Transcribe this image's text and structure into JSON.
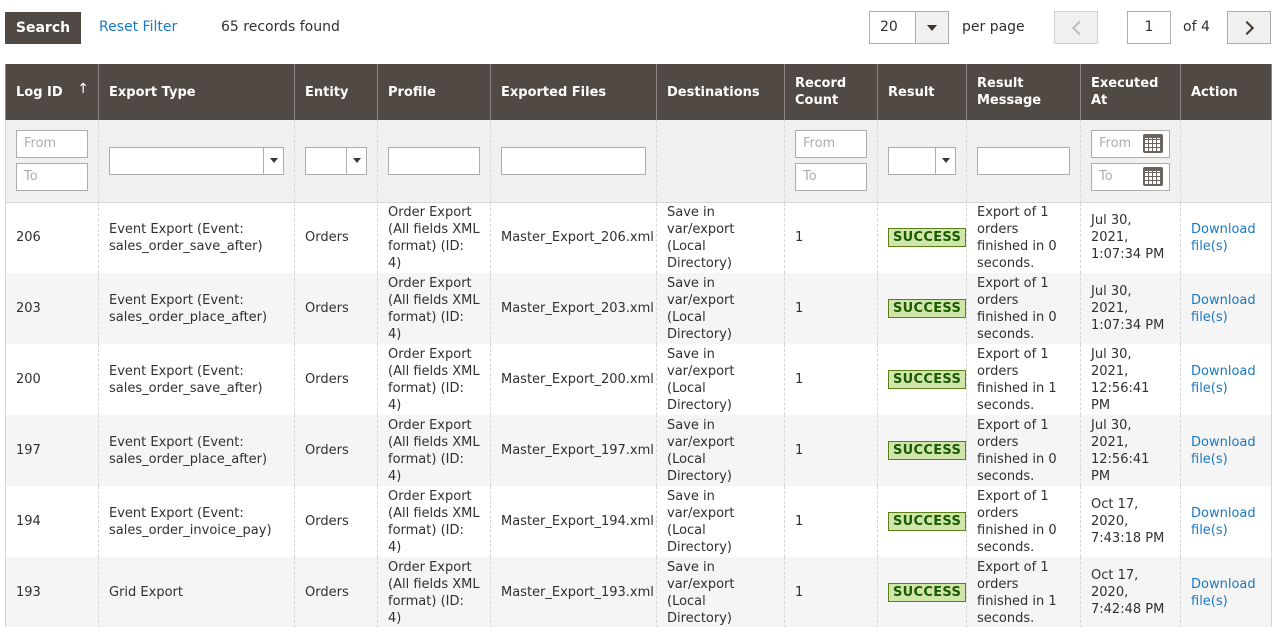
{
  "toolbar": {
    "search_label": "Search",
    "reset_label": "Reset Filter",
    "records_found": "65 records found",
    "per_page_value": "20",
    "per_page_label": "per page",
    "current_page": "1",
    "of_pages": "of 4"
  },
  "columns": [
    "Log ID",
    "Export Type",
    "Entity",
    "Profile",
    "Exported Files",
    "Destinations",
    "Record Count",
    "Result",
    "Result Message",
    "Executed At",
    "Action"
  ],
  "sort_indicator": "↑",
  "filters": {
    "from_placeholder": "From",
    "to_placeholder": "To"
  },
  "rows": [
    {
      "id": "206",
      "export_type": "Event Export (Event: sales_order_save_after)",
      "entity": "Orders",
      "profile": "Order Export (All fields XML format) (ID: 4)",
      "file": "Master_Export_206.xml",
      "destination": "Save in var/export (Local Directory)",
      "count": "1",
      "result": "SUCCESS",
      "message": "Export of 1 orders finished in 0 seconds.",
      "executed": "Jul 30, 2021, 1:07:34 PM",
      "action": "Download file(s)"
    },
    {
      "id": "203",
      "export_type": "Event Export (Event: sales_order_place_after)",
      "entity": "Orders",
      "profile": "Order Export (All fields XML format) (ID: 4)",
      "file": "Master_Export_203.xml",
      "destination": "Save in var/export (Local Directory)",
      "count": "1",
      "result": "SUCCESS",
      "message": "Export of 1 orders finished in 0 seconds.",
      "executed": "Jul 30, 2021, 1:07:34 PM",
      "action": "Download file(s)"
    },
    {
      "id": "200",
      "export_type": "Event Export (Event: sales_order_save_after)",
      "entity": "Orders",
      "profile": "Order Export (All fields XML format) (ID: 4)",
      "file": "Master_Export_200.xml",
      "destination": "Save in var/export (Local Directory)",
      "count": "1",
      "result": "SUCCESS",
      "message": "Export of 1 orders finished in 1 seconds.",
      "executed": "Jul 30, 2021, 12:56:41 PM",
      "action": "Download file(s)"
    },
    {
      "id": "197",
      "export_type": "Event Export (Event: sales_order_place_after)",
      "entity": "Orders",
      "profile": "Order Export (All fields XML format) (ID: 4)",
      "file": "Master_Export_197.xml",
      "destination": "Save in var/export (Local Directory)",
      "count": "1",
      "result": "SUCCESS",
      "message": "Export of 1 orders finished in 0 seconds.",
      "executed": "Jul 30, 2021, 12:56:41 PM",
      "action": "Download file(s)"
    },
    {
      "id": "194",
      "export_type": "Event Export (Event: sales_order_invoice_pay)",
      "entity": "Orders",
      "profile": "Order Export (All fields XML format) (ID: 4)",
      "file": "Master_Export_194.xml",
      "destination": "Save in var/export (Local Directory)",
      "count": "1",
      "result": "SUCCESS",
      "message": "Export of 1 orders finished in 0 seconds.",
      "executed": "Oct 17, 2020, 7:43:18 PM",
      "action": "Download file(s)"
    },
    {
      "id": "193",
      "export_type": "Grid Export",
      "entity": "Orders",
      "profile": "Order Export (All fields XML format) (ID: 4)",
      "file": "Master_Export_193.xml",
      "destination": "Save in var/export (Local Directory)",
      "count": "1",
      "result": "SUCCESS",
      "message": "Export of 1 orders finished in 1 seconds.",
      "executed": "Oct 17, 2020, 7:42:48 PM",
      "action": "Download file(s)"
    }
  ]
}
